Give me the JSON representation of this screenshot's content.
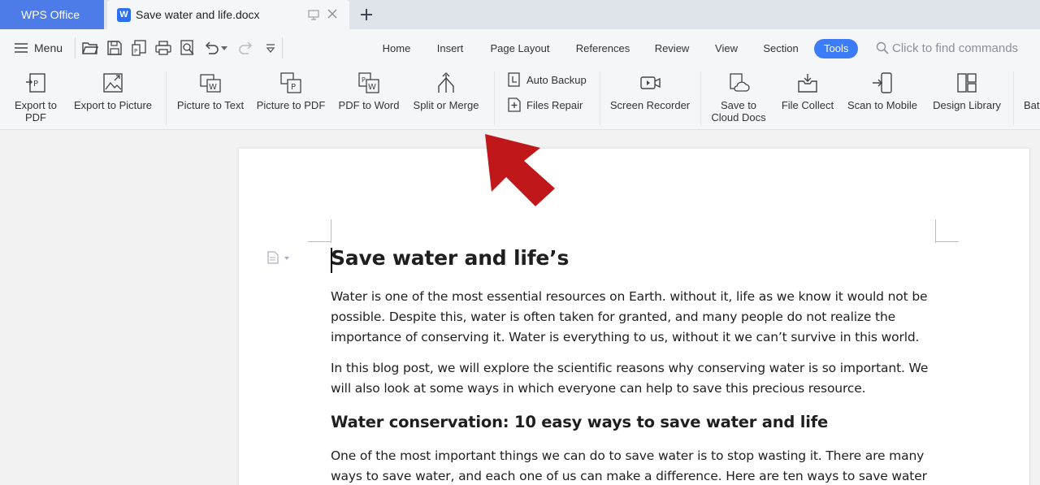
{
  "titlebar": {
    "app_name": "WPS Office",
    "doc_tab_title": "Save water and life.docx",
    "doc_icon_letter": "W"
  },
  "menubar": {
    "menu_label": "Menu",
    "tabs": [
      "Home",
      "Insert",
      "Page Layout",
      "References",
      "Review",
      "View",
      "Section",
      "Tools"
    ],
    "active_tab": "Tools",
    "find_placeholder": "Click to find commands",
    "accent_color": "#3d7bf7"
  },
  "toolbar": {
    "export_pdf": "Export to PDF",
    "export_pdf_l1": "Export to",
    "export_pdf_l2": "PDF",
    "export_picture": "Export to Picture",
    "picture_to_text": "Picture to Text",
    "picture_to_pdf": "Picture to PDF",
    "pdf_to_word": "PDF to Word",
    "split_or_merge": "Split or Merge",
    "auto_backup": "Auto Backup",
    "files_repair": "Files Repair",
    "screen_recorder": "Screen Recorder",
    "save_cloud_l1": "Save to",
    "save_cloud_l2": "Cloud Docs",
    "file_collect": "File Collect",
    "scan_to_mobile": "Scan to Mobile",
    "design_library": "Design Library",
    "batch_partial": "Bat"
  },
  "document": {
    "heading": "Save water and life’s",
    "paragraph1": "Water is one of the most essential resources on Earth. without it, life as we know it would not be possible. Despite this, water is often taken for granted, and many people do not realize the importance of conserving it. Water is everything to us, without it we can’t survive in this world.",
    "paragraph2": "In this blog post, we will explore the scientific reasons why conserving water is so important. We will also look at some ways in which everyone can help to save this precious resource.",
    "subheading": "Water conservation: 10 easy ways to save water and life",
    "paragraph3": "One of the most important things we can do to save water is to stop wasting it. There are many ways to save water, and each one of us can make a difference. Here are ten ways to save water"
  },
  "annotation": {
    "arrow_color": "#c0181a"
  }
}
